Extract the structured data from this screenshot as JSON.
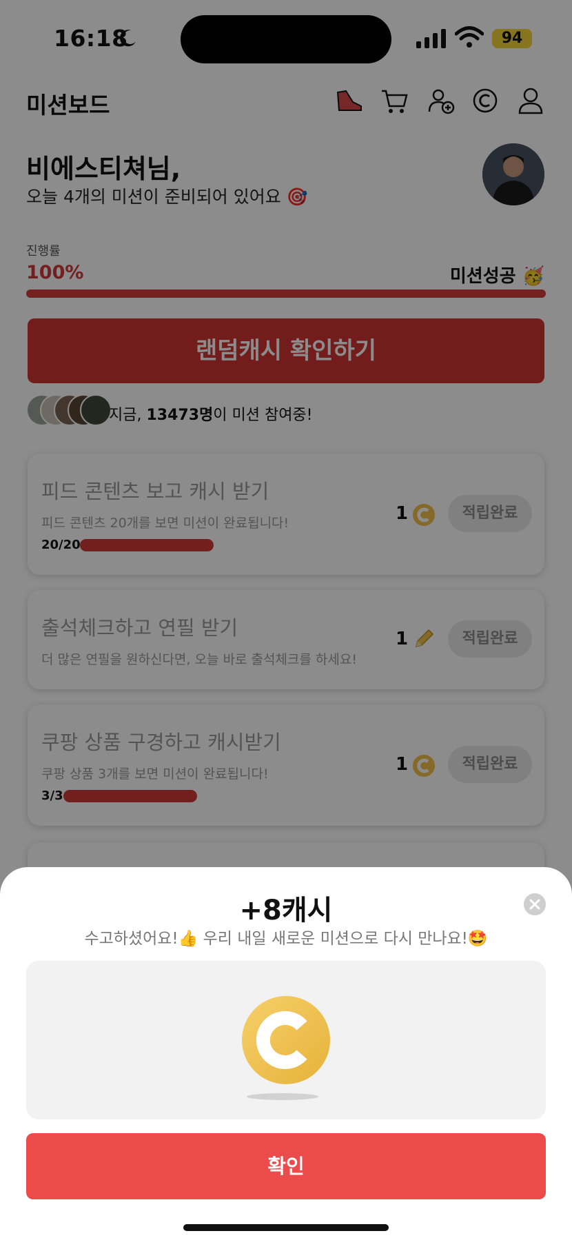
{
  "status_bar": {
    "time": "16:18",
    "battery": "94"
  },
  "header": {
    "title": "미션보드"
  },
  "greeting": {
    "name": "비에스티쳐님,",
    "message": "오늘 4개의 미션이 준비되어 있어요 🎯"
  },
  "progress": {
    "label": "진행률",
    "percent_text": "100%",
    "value": 1.0,
    "status": "미션성공 🥳"
  },
  "random_cash_button": "랜덤캐시 확인하기",
  "participants": {
    "prefix": "지금, ",
    "count": "13473명",
    "suffix": "이 미션 참여중!"
  },
  "missions": [
    {
      "title": "피드 콘텐츠 보고 캐시 받기",
      "desc": "피드 콘텐츠 20개를 보면 미션이 완료됩니다!",
      "count": "20/20",
      "reward": "1",
      "reward_icon": "cash-coin-icon",
      "button": "적립완료"
    },
    {
      "title": "출석체크하고 연필 받기",
      "desc": "더 많은 연필을 원하신다면, 오늘 바로 출석체크를 하세요!",
      "reward": "1",
      "reward_icon": "pencil-icon",
      "button": "적립완료"
    },
    {
      "title": "쿠팡 상품 구경하고 캐시받기",
      "desc": "쿠팡 상품 3개를 보면 미션이 완료됩니다!",
      "count": "3/3",
      "reward": "1",
      "reward_icon": "cash-coin-icon",
      "button": "적립완료"
    }
  ],
  "sheet": {
    "title": "+8캐시",
    "message": "수고하셨어요!👍 우리 내일 새로운 미션으로 다시 만나요!🤩",
    "confirm": "확인"
  },
  "colors": {
    "accent": "#ec4b4b",
    "coin": "#f2c14e"
  }
}
